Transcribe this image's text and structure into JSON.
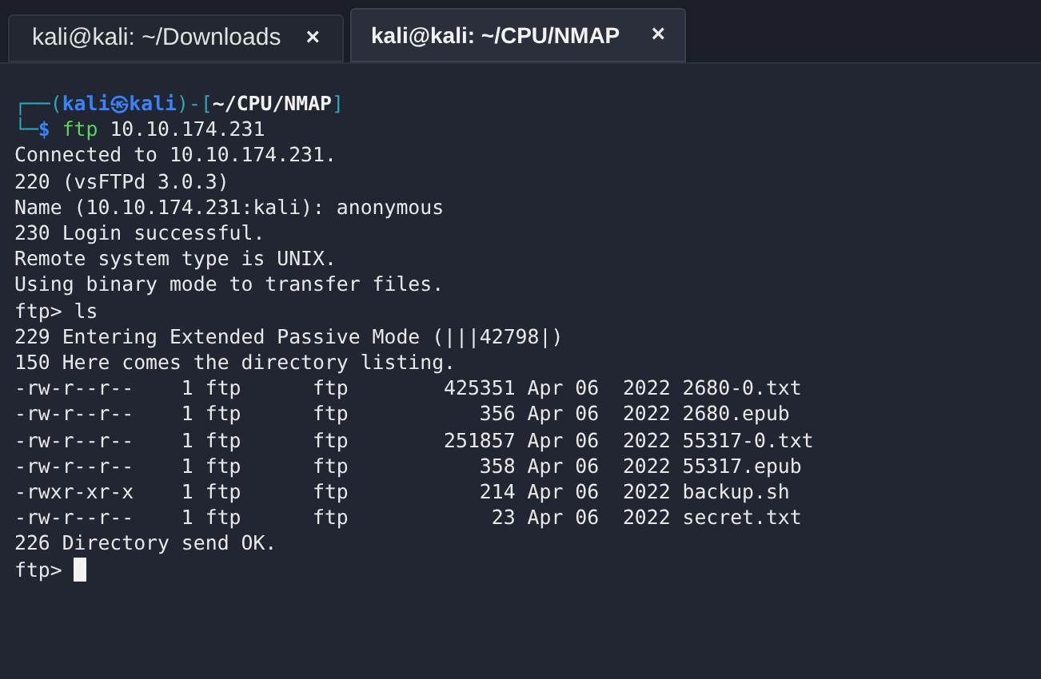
{
  "tabs": [
    {
      "label": "kali@kali: ~/Downloads",
      "close": "×",
      "selected": false
    },
    {
      "label": "kali@kali: ~/CPU/NMAP",
      "close": "×",
      "selected": true
    }
  ],
  "prompt": {
    "segments": [
      {
        "kind": "frame",
        "text": "┌──("
      },
      {
        "kind": "host",
        "text": "kali㉿kali"
      },
      {
        "kind": "frame",
        "text": ")-["
      },
      {
        "kind": "path",
        "text": "~/CPU/NMAP"
      },
      {
        "kind": "frame",
        "text": "]"
      }
    ],
    "command_segments": [
      {
        "kind": "frame",
        "text": "└─"
      },
      {
        "kind": "host",
        "text": "$ "
      },
      {
        "kind": "command",
        "text": "ftp"
      },
      {
        "kind": "arg",
        "text": " 10.10.174.231"
      }
    ]
  },
  "output": [
    "Connected to 10.10.174.231.",
    "220 (vsFTPd 3.0.3)",
    "Name (10.10.174.231:kali): anonymous",
    "230 Login successful.",
    "Remote system type is UNIX.",
    "Using binary mode to transfer files.",
    "ftp> ls",
    "229 Entering Extended Passive Mode (|||42798|)",
    "150 Here comes the directory listing.",
    "-rw-r--r--    1 ftp      ftp        425351 Apr 06  2022 2680-0.txt",
    "-rw-r--r--    1 ftp      ftp           356 Apr 06  2022 2680.epub",
    "-rw-r--r--    1 ftp      ftp        251857 Apr 06  2022 55317-0.txt",
    "-rw-r--r--    1 ftp      ftp           358 Apr 06  2022 55317.epub",
    "-rwxr-xr-x    1 ftp      ftp           214 Apr 06  2022 backup.sh",
    "-rw-r--r--    1 ftp      ftp            23 Apr 06  2022 secret.txt",
    "226 Directory send OK."
  ],
  "input_prompt": "ftp> "
}
